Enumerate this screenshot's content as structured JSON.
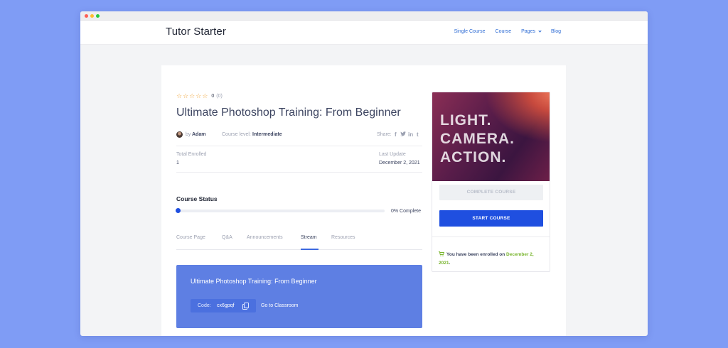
{
  "site": {
    "logo": "Tutor Starter",
    "nav": [
      {
        "label": "Single Course"
      },
      {
        "label": "Course"
      },
      {
        "label": "Pages"
      },
      {
        "label": "Blog"
      }
    ]
  },
  "course": {
    "rating_value": "0",
    "rating_count": "(0)",
    "stars": 5,
    "title": "Ultimate Photoshop Training: From Beginner",
    "by_label": "by",
    "author": "Adam",
    "level_label": "Course level:",
    "level": "Intermediate",
    "share_label": "Share:",
    "share_icons": [
      "facebook-icon",
      "twitter-icon",
      "linkedin-icon",
      "tumblr-icon"
    ],
    "total_enrolled_label": "Total Enrolled",
    "total_enrolled": "1",
    "last_update_label": "Last Update",
    "last_update": "December 2, 2021",
    "status_title": "Course Status",
    "progress_percent": 0,
    "progress_label": "0% Complete"
  },
  "tabs": [
    {
      "label": "Course Page"
    },
    {
      "label": "Q&A"
    },
    {
      "label": "Announcements"
    },
    {
      "label": "Stream",
      "active": true
    },
    {
      "label": "Resources"
    }
  ],
  "stream": {
    "title": "Ultimate Photoshop Training: From Beginner",
    "code_label": "Code:",
    "code": "cx6gpqf",
    "classroom_link": "Go to Classroom"
  },
  "sidebar": {
    "thumbnail_lines": [
      "LIGHT.",
      "CAMERA.",
      "ACTION."
    ],
    "complete_button": "COMPLETE COURSE",
    "start_button": "START COURSE",
    "enrolled_text": "You have been enrolled on",
    "enrolled_date": "December 2, 2021",
    "enrolled_suffix": "."
  },
  "colors": {
    "background": "#7f9cf5",
    "primary": "#1f4fe0",
    "stream_card": "#5e7fe3",
    "star": "#f0a63c",
    "enrolled_date": "#79b52e"
  }
}
